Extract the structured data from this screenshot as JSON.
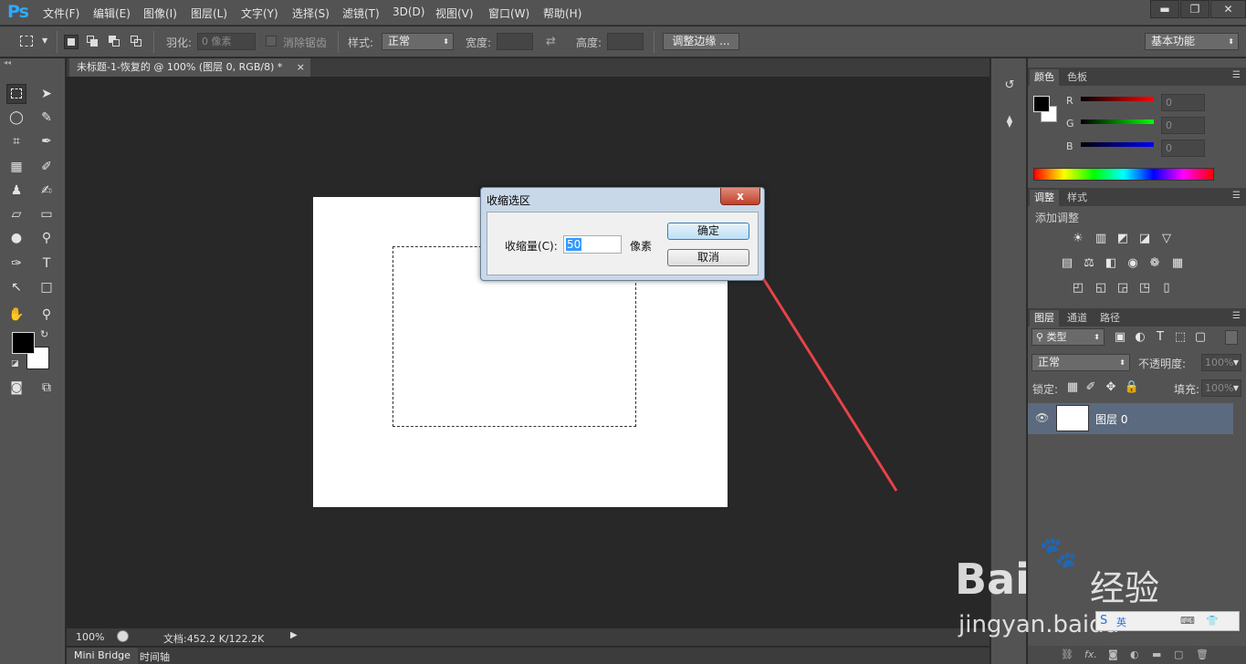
{
  "app": {
    "logo": "Ps"
  },
  "menu": [
    "文件(F)",
    "编辑(E)",
    "图像(I)",
    "图层(L)",
    "文字(Y)",
    "选择(S)",
    "滤镜(T)",
    "3D(D)",
    "视图(V)",
    "窗口(W)",
    "帮助(H)"
  ],
  "window_controls": {
    "minimize": "▬",
    "restore": "❐",
    "close": "✕"
  },
  "options": {
    "feather_label": "羽化:",
    "feather_value": "0 像素",
    "antialias_label": "消除锯齿",
    "style_label": "样式:",
    "style_value": "正常",
    "width_label": "宽度:",
    "height_label": "高度:",
    "refine_edge": "调整边缘 ...",
    "workspace": "基本功能"
  },
  "document": {
    "tab_title": "未标题-1-恢复的 @ 100% (图层 0, RGB/8) *",
    "tab_close": "×"
  },
  "status": {
    "zoom": "100%",
    "doc_info": "文档:452.2 K/122.2K"
  },
  "bottom_tabs": [
    "Mini Bridge",
    "时间轴"
  ],
  "color_panel": {
    "tabs": [
      "颜色",
      "色板"
    ],
    "channels": [
      {
        "label": "R",
        "value": "0",
        "color": "#ff0000"
      },
      {
        "label": "G",
        "value": "0",
        "color": "#00ff00"
      },
      {
        "label": "B",
        "value": "0",
        "color": "#0000ff"
      }
    ]
  },
  "adjust_panel": {
    "tabs": [
      "调整",
      "样式"
    ],
    "title": "添加调整"
  },
  "layers_panel": {
    "tabs": [
      "图层",
      "通道",
      "路径"
    ],
    "filter_label": "类型",
    "blend_mode": "正常",
    "opacity_label": "不透明度:",
    "opacity_value": "100%",
    "lock_label": "锁定:",
    "fill_label": "填充:",
    "fill_value": "100%",
    "layers": [
      {
        "name": "图层 0"
      }
    ]
  },
  "dialog": {
    "title": "收缩选区",
    "field_label": "收缩量(C):",
    "field_value": "50",
    "unit": "像素",
    "ok": "确定",
    "cancel": "取消",
    "close": "x"
  },
  "watermark": {
    "logo": "Bai",
    "logo2": "经验",
    "url": "jingyan.baidu"
  }
}
